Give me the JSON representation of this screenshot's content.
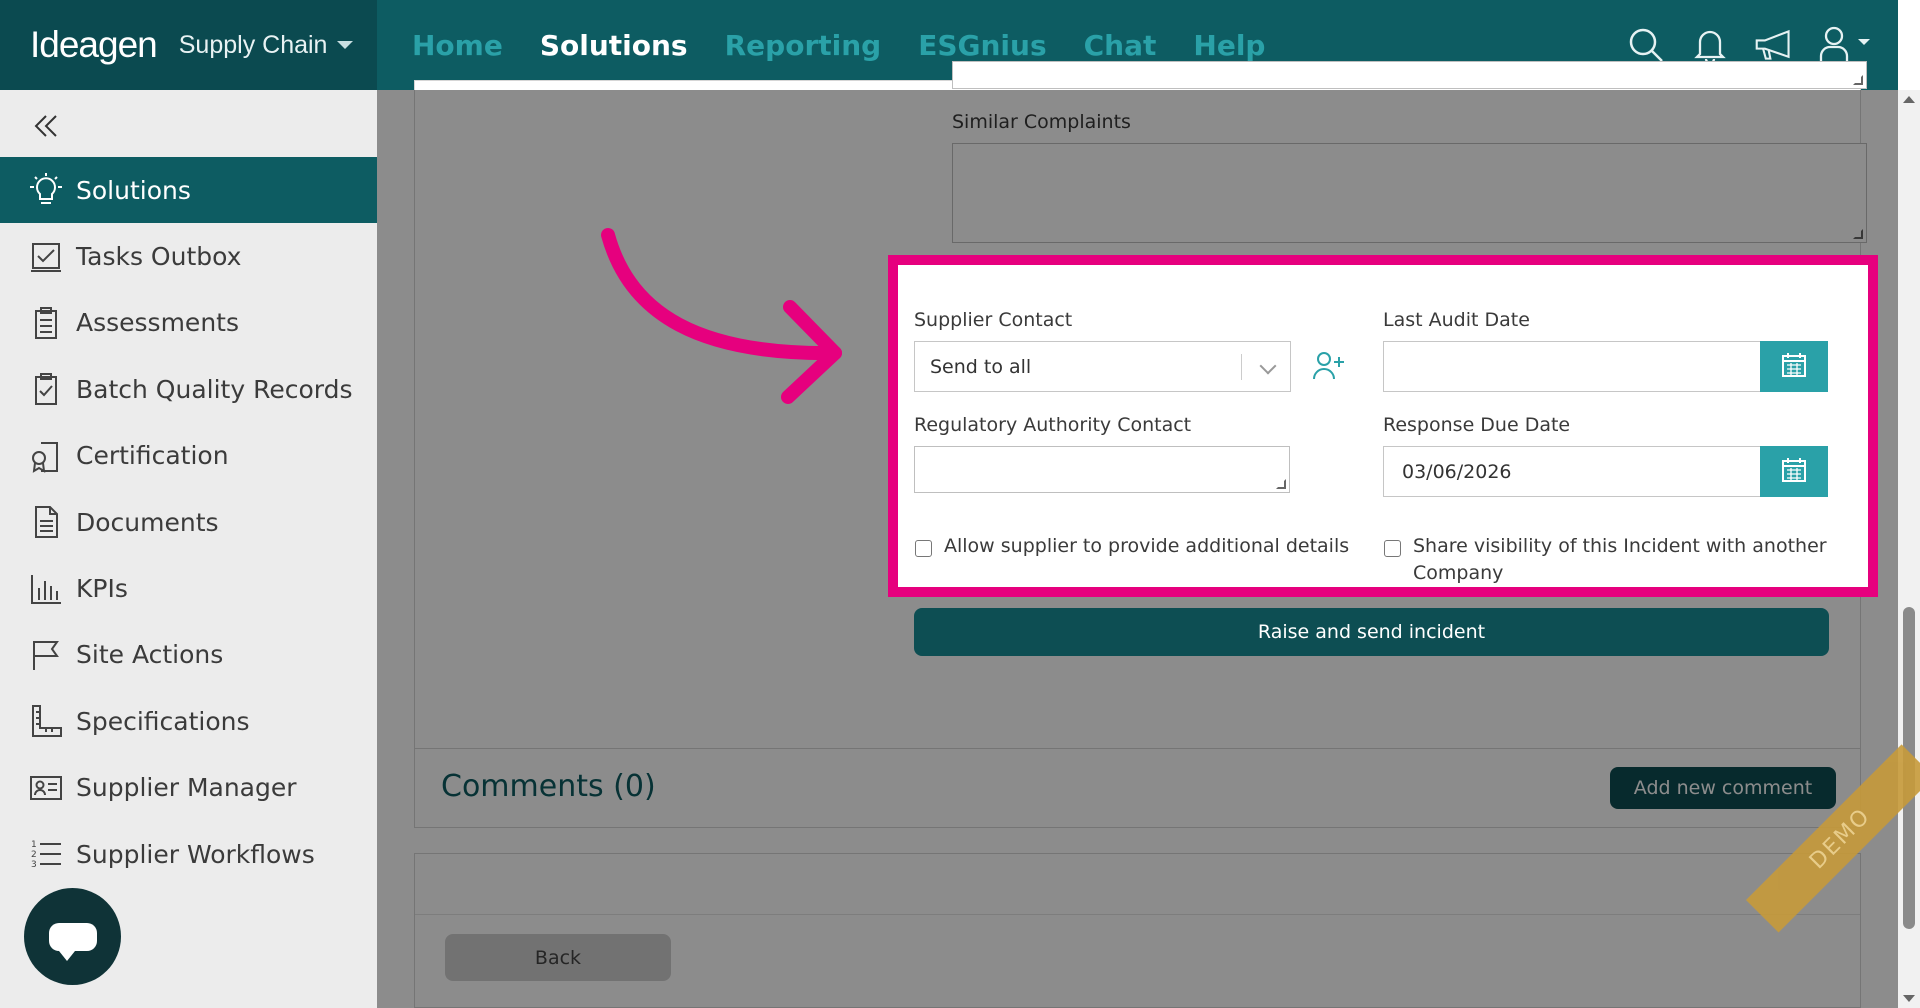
{
  "brand": {
    "logo": "Ideagen",
    "product": "Supply Chain"
  },
  "nav": {
    "items": [
      {
        "label": "Home"
      },
      {
        "label": "Solutions"
      },
      {
        "label": "Reporting"
      },
      {
        "label": "ESGnius"
      },
      {
        "label": "Chat"
      },
      {
        "label": "Help"
      }
    ],
    "active": "Solutions"
  },
  "top_icons": [
    "search-icon",
    "bell-icon",
    "megaphone-icon",
    "user-icon"
  ],
  "sidebar": {
    "items": [
      {
        "label": "Solutions",
        "icon": "lightbulb-icon",
        "active": true
      },
      {
        "label": "Tasks Outbox",
        "icon": "outbox-icon"
      },
      {
        "label": "Assessments",
        "icon": "clipboard-icon"
      },
      {
        "label": "Batch Quality Records",
        "icon": "clipboard-check-icon"
      },
      {
        "label": "Certification",
        "icon": "certificate-icon"
      },
      {
        "label": "Documents",
        "icon": "document-icon"
      },
      {
        "label": "KPIs",
        "icon": "bar-chart-icon"
      },
      {
        "label": "Site Actions",
        "icon": "flag-icon"
      },
      {
        "label": "Specifications",
        "icon": "ruler-icon"
      },
      {
        "label": "Supplier Manager",
        "icon": "id-card-icon"
      },
      {
        "label": "Supplier Workflows",
        "icon": "numbered-list-icon"
      }
    ]
  },
  "form": {
    "similar_complaints_label": "Similar Complaints",
    "supplier_contact_label": "Supplier Contact",
    "supplier_contact_value": "Send to all",
    "last_audit_date_label": "Last Audit Date",
    "last_audit_date_value": "",
    "regulatory_authority_label": "Regulatory Authority Contact",
    "response_due_date_label": "Response Due Date",
    "response_due_date_value": "03/06/2026",
    "allow_supplier_label": "Allow supplier to provide additional details",
    "allow_supplier_checked": false,
    "share_visibility_label": "Share visibility of this Incident with another Company",
    "share_visibility_checked": false,
    "raise_button": "Raise and send incident"
  },
  "comments": {
    "title": "Comments (0)",
    "add_button": "Add new comment"
  },
  "back_button": "Back",
  "demo_ribbon": "DEMO",
  "colors": {
    "header": "#0d5c62",
    "accent": "#2aa1a8",
    "highlight": "#e6007e",
    "button": "#0d4e53"
  }
}
